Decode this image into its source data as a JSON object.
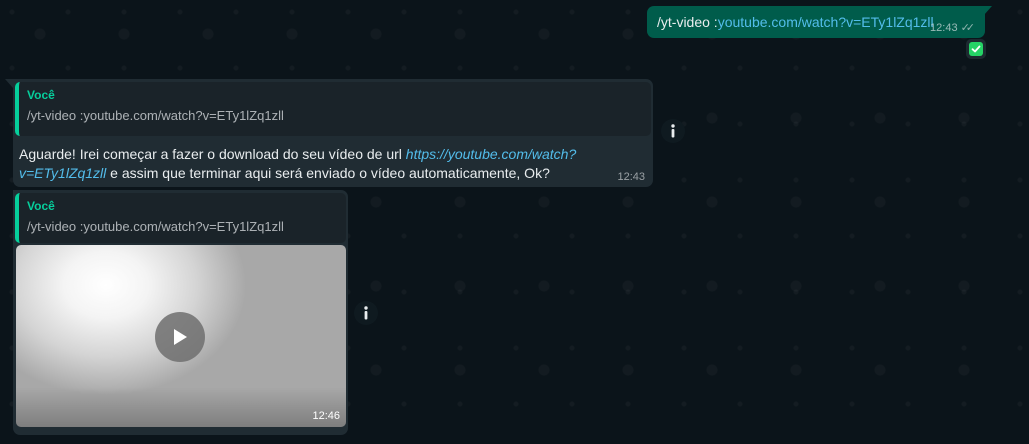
{
  "outgoing": {
    "command": "/yt-video :",
    "link": "youtube.com/watch?v=ETy1lZq1zll",
    "time": "12:43"
  },
  "reply_text": {
    "author": "Você",
    "quoted": "/yt-video :youtube.com/watch?v=ETy1lZq1zll",
    "body_before": "Aguarde! Irei começar a fazer o download do seu vídeo de url ",
    "body_link": "https://youtube.com/watch?v=ETy1lZq1zll",
    "body_after": " e assim que terminar aqui será enviado o vídeo automaticamente, Ok?",
    "time": "12:43"
  },
  "reply_video": {
    "author": "Você",
    "quoted": "/yt-video :youtube.com/watch?v=ETy1lZq1zll",
    "time": "12:46"
  },
  "colors": {
    "background": "#0b141a",
    "outgoing_bubble": "#005c4b",
    "incoming_bubble": "#202c33",
    "quote_accent": "#06cf9c",
    "link": "#53bdeb"
  },
  "icons": [
    "check-icon",
    "info-icon",
    "play-icon",
    "double-check-icon"
  ]
}
